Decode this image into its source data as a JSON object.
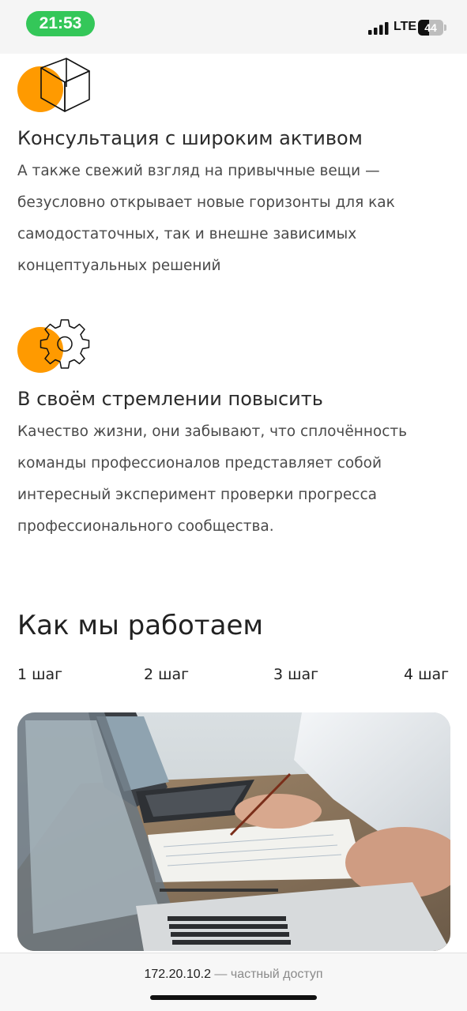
{
  "status": {
    "time": "21:53",
    "network": "LTE",
    "battery_level": "44",
    "battery_fraction": 0.44,
    "accent": "#34c759"
  },
  "features": [
    {
      "icon": "cube-icon",
      "title": "Консультация с широким активом",
      "text_lines": [
        "А также свежий взгляд на привычные вещи —",
        "безусловно открывает новые горизонты для как",
        "самодостаточных, так и внешне зависимых",
        "концептуальных решений"
      ]
    },
    {
      "icon": "gear-icon",
      "title": "В своём стремлении повысить",
      "text_lines": [
        "Качество жизни, они забывают, что сплочённость",
        "команды профессионалов представляет собой",
        "интересный эксперимент проверки прогресса",
        "профессионального сообщества."
      ]
    }
  ],
  "icon_accent": "#ff9a00",
  "how_we_work": {
    "title": "Как мы работаем",
    "steps": [
      "1 шаг",
      "2 шаг",
      "3 шаг",
      "4 шаг"
    ]
  },
  "photo": {
    "subject": "laptops-and-documents-image"
  },
  "address_bar": {
    "host": "172.20.10.2",
    "note": " — частный доступ"
  }
}
